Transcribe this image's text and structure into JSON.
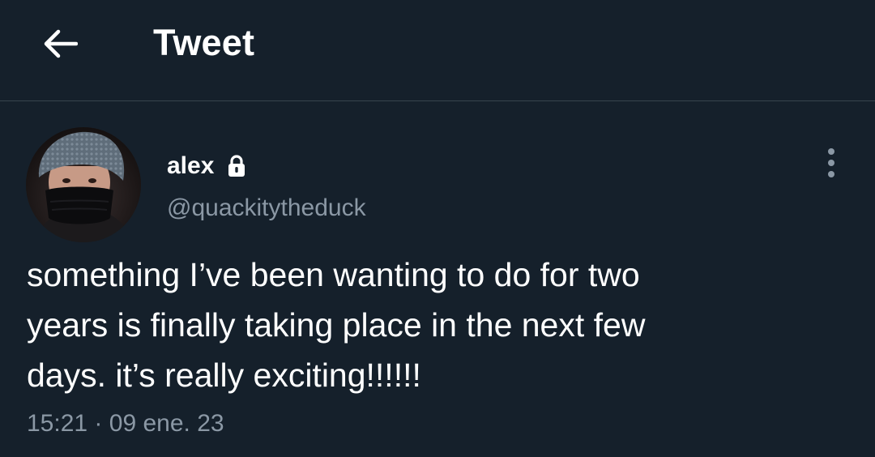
{
  "header": {
    "title": "Tweet",
    "back_icon": "arrow-left-icon"
  },
  "tweet": {
    "author": {
      "display_name": "alex",
      "handle": "@quackitytheduck",
      "protected_icon": "lock-icon",
      "avatar": "profile-photo"
    },
    "more_icon": "more-vertical-icon",
    "text": "something I’ve been wanting to do for two\nyears is finally taking place in the next few\ndays. it’s really exciting!!!!!!",
    "time": "15:21",
    "separator": "·",
    "date": "09 ene. 23"
  },
  "colors": {
    "background": "#15202b",
    "divider": "#38444d",
    "primary_text": "#ffffff",
    "secondary_text": "#8b98a5"
  }
}
